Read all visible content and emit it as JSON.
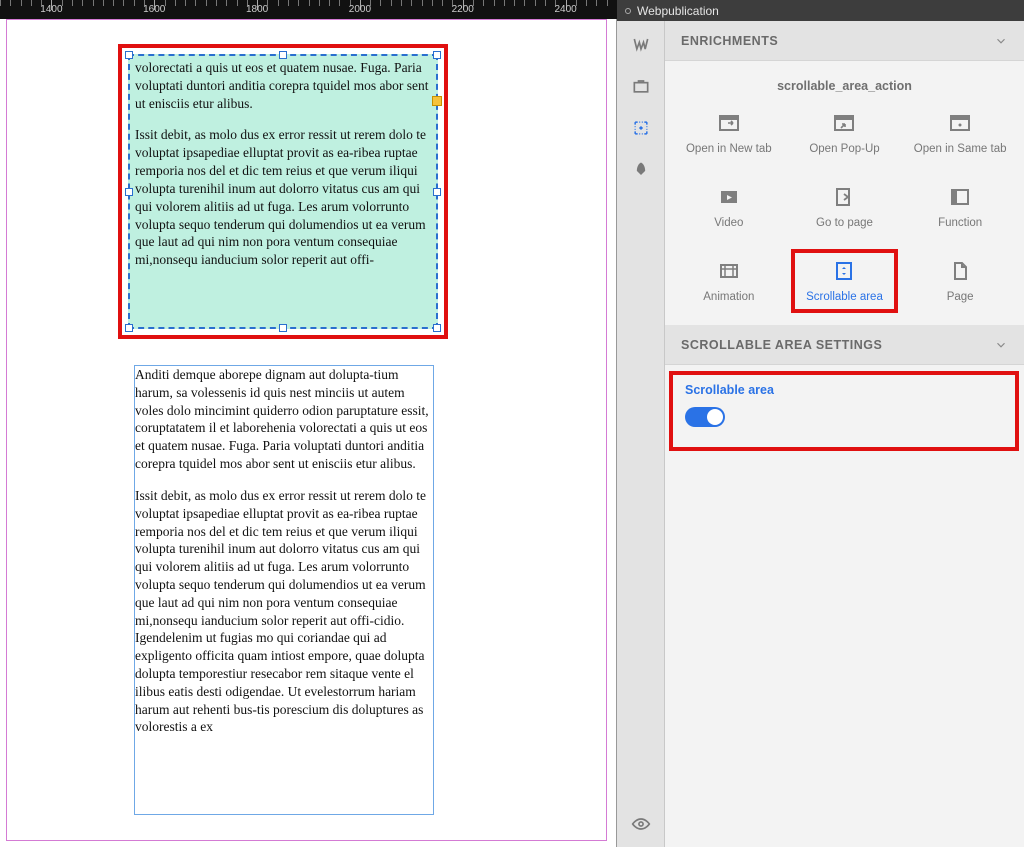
{
  "ruler": {
    "marks": [
      1400,
      1600,
      1800,
      2000,
      2200,
      2400
    ]
  },
  "canvas": {
    "frame1": {
      "para1": "volorectati a quis ut eos et quatem nusae. Fuga. Paria voluptati duntori anditia coreprа tquidel mos abor sent ut enisciis etur alibus.",
      "para2": "Issit debit, as molo dus ex error ressit ut rerem dolo te voluptat ipsapediae elluptat provit as ea-ribea ruptae remporia nos del et dic tem reius et que verum iliqui volupta turenihil inum aut dolorro vitatus cus am qui qui volorem alitiis ad ut fuga. Les arum volorrunto volupta sequo tenderum qui dolumendios ut ea verum que laut ad qui nim non pora ventum consequiae mi,nonsequ ianducium solor reperit aut offi-"
    },
    "frame2": {
      "para1": "Anditi demque aborepe dignam aut dolupta-tium harum, sa volessenis id quis nest minciis ut autem voles dolo mincimint quiderro odion paruptature essit, coruptatatem il et laborehenia volorectati a quis ut eos et quatem nusae. Fuga. Paria voluptati duntori anditia coreprа tquidel mos abor sent ut enisciis etur alibus.",
      "para2": "Issit debit, as molo dus ex error ressit ut rerem dolo te voluptat ipsapediae elluptat provit as ea-ribea ruptae remporia nos del et dic tem reius et que verum iliqui volupta turenihil inum aut dolorro vitatus cus am qui qui volorem alitiis ad ut fuga. Les arum volorrunto volupta sequo tenderum qui dolumendios ut ea verum que laut ad qui nim non pora ventum consequiae mi,nonsequ ianducium solor reperit aut offi-cidio. Igendelenim ut fugias mo qui coriandae qui ad expligento officita quam intiost empore, quae dolupta dolupta temporestіur resecabor rem sitaque vente el ilibus eatis desti odigendae. Ut evelestorrum hariam harum aut rehenti bus-tis porescium dis doluptures as volorestis a ex"
    }
  },
  "panel": {
    "title": "Webpublication",
    "enrichments_heading": "ENRICHMENTS",
    "action_subhead": "scrollable_area_action",
    "items": [
      {
        "label": "Open in New tab",
        "icon": "newtab"
      },
      {
        "label": "Open Pop-Up",
        "icon": "popup"
      },
      {
        "label": "Open in Same tab",
        "icon": "sametab"
      },
      {
        "label": "Video",
        "icon": "video"
      },
      {
        "label": "Go to page",
        "icon": "gotopage"
      },
      {
        "label": "Function",
        "icon": "function"
      },
      {
        "label": "Animation",
        "icon": "animation"
      },
      {
        "label": "Scrollable area",
        "icon": "scrollable",
        "selected": true
      },
      {
        "label": "Page",
        "icon": "page"
      }
    ],
    "settings_heading": "SCROLLABLE AREA SETTINGS",
    "settings": {
      "scrollable_label": "Scrollable area",
      "scrollable_on": true
    }
  }
}
